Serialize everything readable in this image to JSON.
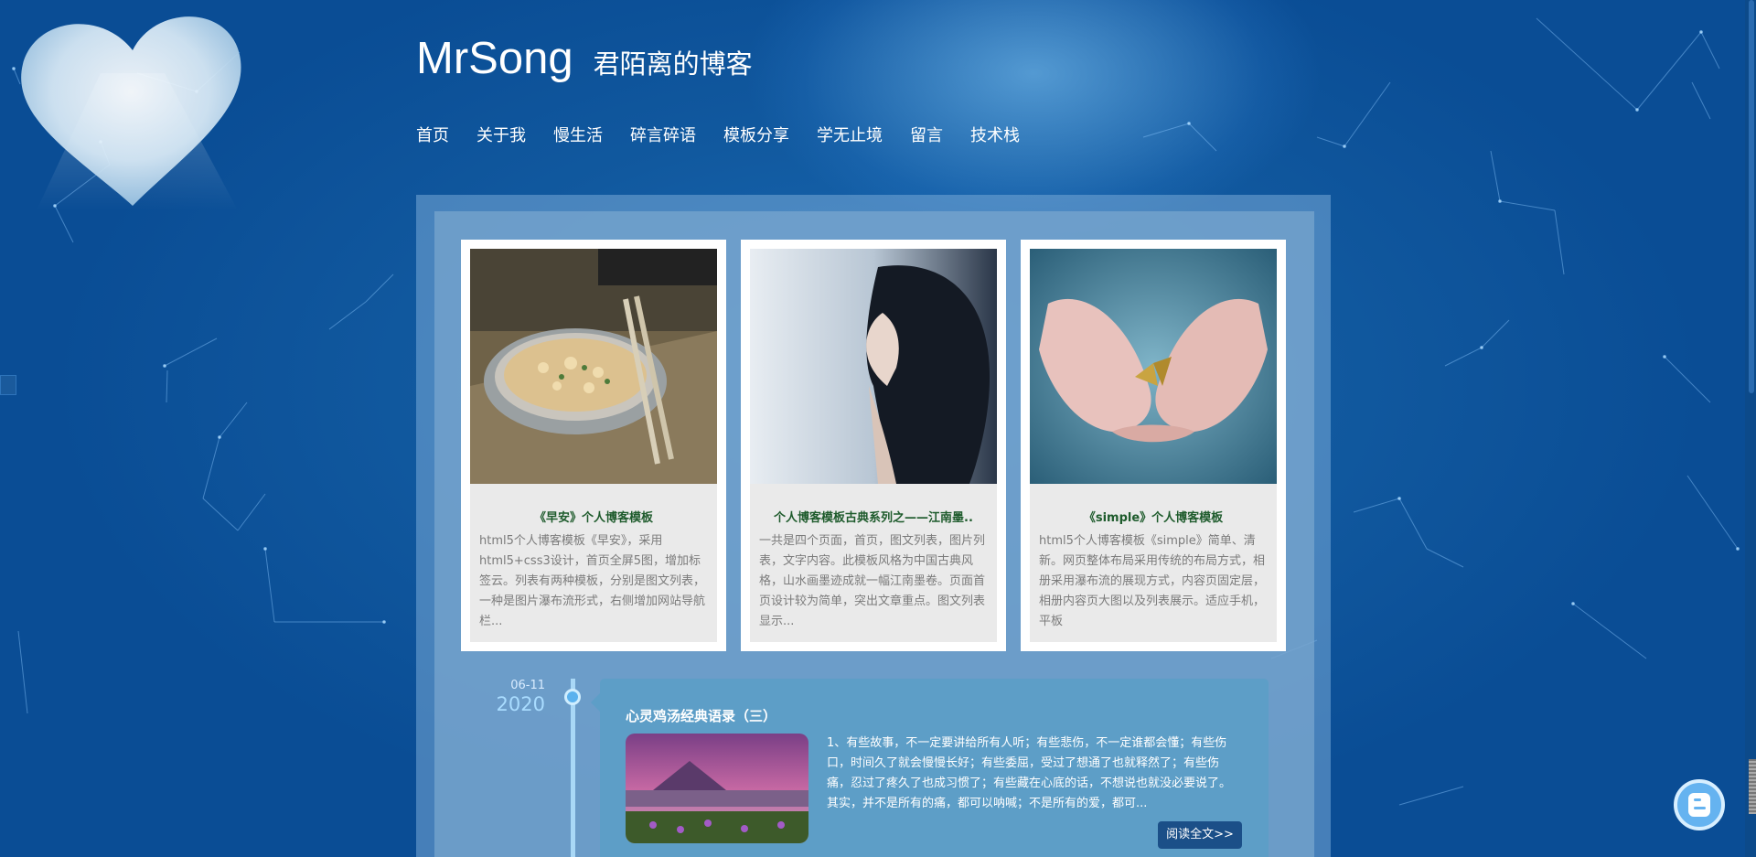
{
  "header": {
    "title": "MrSong",
    "subtitle": "君陌离的博客"
  },
  "nav": [
    {
      "label": "首页"
    },
    {
      "label": "关于我"
    },
    {
      "label": "慢生活"
    },
    {
      "label": "碎言碎语"
    },
    {
      "label": "模板分享"
    },
    {
      "label": "学无止境"
    },
    {
      "label": "留言"
    },
    {
      "label": "技术栈"
    }
  ],
  "cards": [
    {
      "title": "《早安》个人博客模板",
      "desc": "html5个人博客模板《早安》，采用html5+css3设计，首页全屏5图，增加标签云。列表有两种模板，分别是图文列表，一种是图片瀑布流形式，右侧增加网站导航栏..."
    },
    {
      "title": "个人博客模板古典系列之——江南墨..",
      "desc": "一共是四个页面，首页，图文列表，图片列表，文字内容。此模板风格为中国古典风格，山水画墨迹成就一幅江南墨卷。页面首页设计较为简单，突出文章重点。图文列表显示..."
    },
    {
      "title": "《simple》个人博客模板",
      "desc": "html5个人博客模板《simple》简单、清新。网页整体布局采用传统的布局方式，相册采用瀑布流的展现方式，内容页固定层，相册内容页大图以及列表展示。适应手机，平板"
    }
  ],
  "timeline": {
    "month_day": "06-11",
    "year": "2020"
  },
  "post": {
    "title": "心灵鸡汤经典语录（三）",
    "text": "1、有些故事，不一定要讲给所有人听；有些悲伤，不一定谁都会懂；有些伤口，时间久了就会慢慢长好；有些委屈，受过了想通了也就释然了；有些伤痛，忍过了疼久了也成习惯了；有些藏在心底的话，不想说也就没必要说了。其实，并不是所有的痛，都可以呐喊；不是所有的爱，都可...",
    "read_more": "阅读全文>>"
  },
  "colors": {
    "background": "#0f5aa6",
    "card_title": "#1e5b2c",
    "post_bg": "#5d9ec7",
    "button": "#1b4f88"
  }
}
